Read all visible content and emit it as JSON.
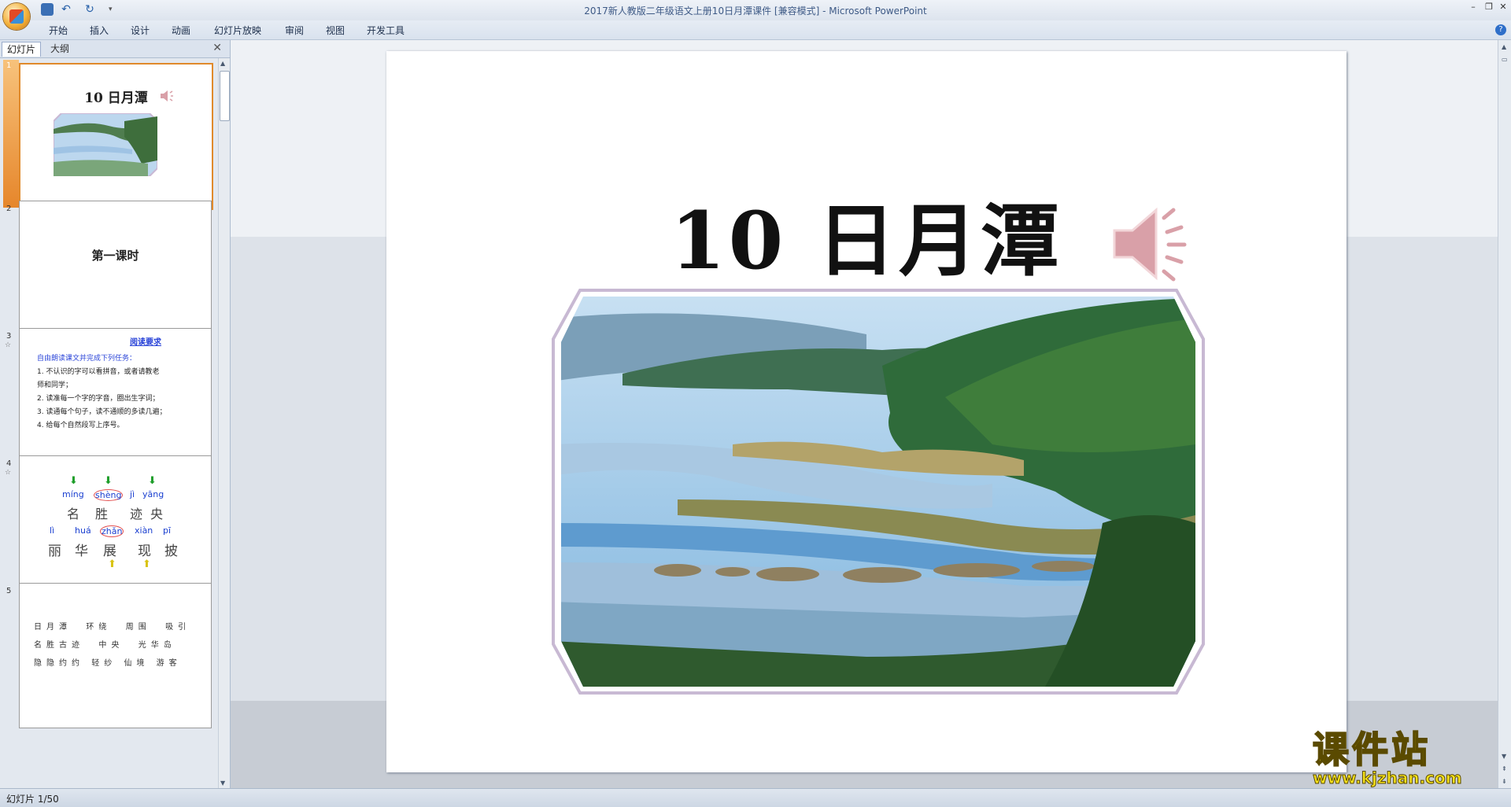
{
  "window": {
    "title": "2017新人教版二年级语文上册10日月潭课件 [兼容模式] - Microsoft PowerPoint",
    "controls": [
      "–",
      "❐",
      "✕"
    ]
  },
  "ribbon": {
    "tabs": [
      "开始",
      "插入",
      "设计",
      "动画",
      "幻灯片放映",
      "审阅",
      "视图",
      "开发工具"
    ]
  },
  "pane": {
    "tab_slides": "幻灯片",
    "tab_outline": "大纲",
    "close": "✕"
  },
  "thumbnails": [
    {
      "num": "1",
      "title": "10 日月潭"
    },
    {
      "num": "2",
      "title": "第一课时"
    },
    {
      "num": "3",
      "heading": "阅读要求",
      "lines": [
        "自由朗读课文并完成下列任务：",
        "1. 不认识的字可以看拼音，或者请教老",
        "师和同学；",
        "2. 读准每一个字的字音，圈出生字词；",
        "3. 读通每个句子，读不通顺的多读几遍；",
        "4. 给每个自然段写上序号。"
      ]
    },
    {
      "num": "4",
      "row1_pinyin": [
        "míng",
        "shèng",
        "jì",
        "yāng"
      ],
      "row1_chars": [
        "名",
        "胜",
        "迹",
        "央"
      ],
      "row2_pinyin": [
        "lì",
        "huá",
        "zhǎn",
        "xiàn",
        "pī"
      ],
      "row2_chars": [
        "丽",
        "华",
        "展",
        "现",
        "披"
      ]
    },
    {
      "num": "5",
      "rows": [
        [
          "日",
          "月",
          "潭",
          "环",
          "绕",
          "周",
          "围",
          "吸",
          "引"
        ],
        [
          "名",
          "胜",
          "古",
          "迹",
          "中",
          "央",
          "光",
          "华",
          "岛"
        ],
        [
          "隐",
          "隐",
          "约",
          "约",
          "轻",
          "纱",
          "仙",
          "境",
          "游",
          "客"
        ]
      ]
    }
  ],
  "slide": {
    "title": "10  日月潭"
  },
  "status": {
    "text": "幻灯片 1/50"
  },
  "watermark": {
    "line1": "课件站",
    "line2": "www.kjzhan.com"
  },
  "colors": {
    "accent": "#e08a2c",
    "speaker": "#d9a0a8",
    "pinyin": "#1a3fd0"
  }
}
